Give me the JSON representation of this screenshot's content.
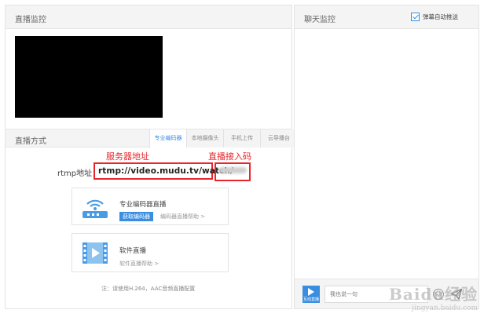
{
  "left_panel": {
    "title": "直播监控",
    "method_title": "直播方式",
    "tabs": [
      {
        "label": "专业编码器",
        "active": true
      },
      {
        "label": "本地摄像头",
        "active": false
      },
      {
        "label": "手机上传",
        "active": false
      },
      {
        "label": "云导播台",
        "active": false
      }
    ],
    "annotations": {
      "server_address": "服务器地址",
      "stream_code": "直播接入码"
    },
    "rtmp": {
      "label": "rtmp地址：",
      "url": "rtmp://video.mudu.tv/watch/"
    },
    "cards": [
      {
        "title": "专业编码器直播",
        "button": "获取编码器",
        "link": "编码器直播帮助 >",
        "icon": "router-wifi-icon"
      },
      {
        "title": "软件直播",
        "link": "软件直播帮助 >",
        "icon": "film-play-icon"
      }
    ],
    "note": "注：请使用H.264，AAC音频直播配置"
  },
  "right_panel": {
    "title": "聊天监控",
    "barrage_auto_push_label": "弹幕自动推送",
    "barrage_auto_push_checked": true,
    "media_button_label": "互动直播",
    "chat_placeholder": "我也说一句"
  },
  "watermark": {
    "main": "Baidu经验",
    "sub": "jingyan.baidu.com"
  },
  "colors": {
    "accent": "#3b8de0",
    "annotation_red": "#e8262a",
    "panel_header": "#f4f4f4"
  }
}
